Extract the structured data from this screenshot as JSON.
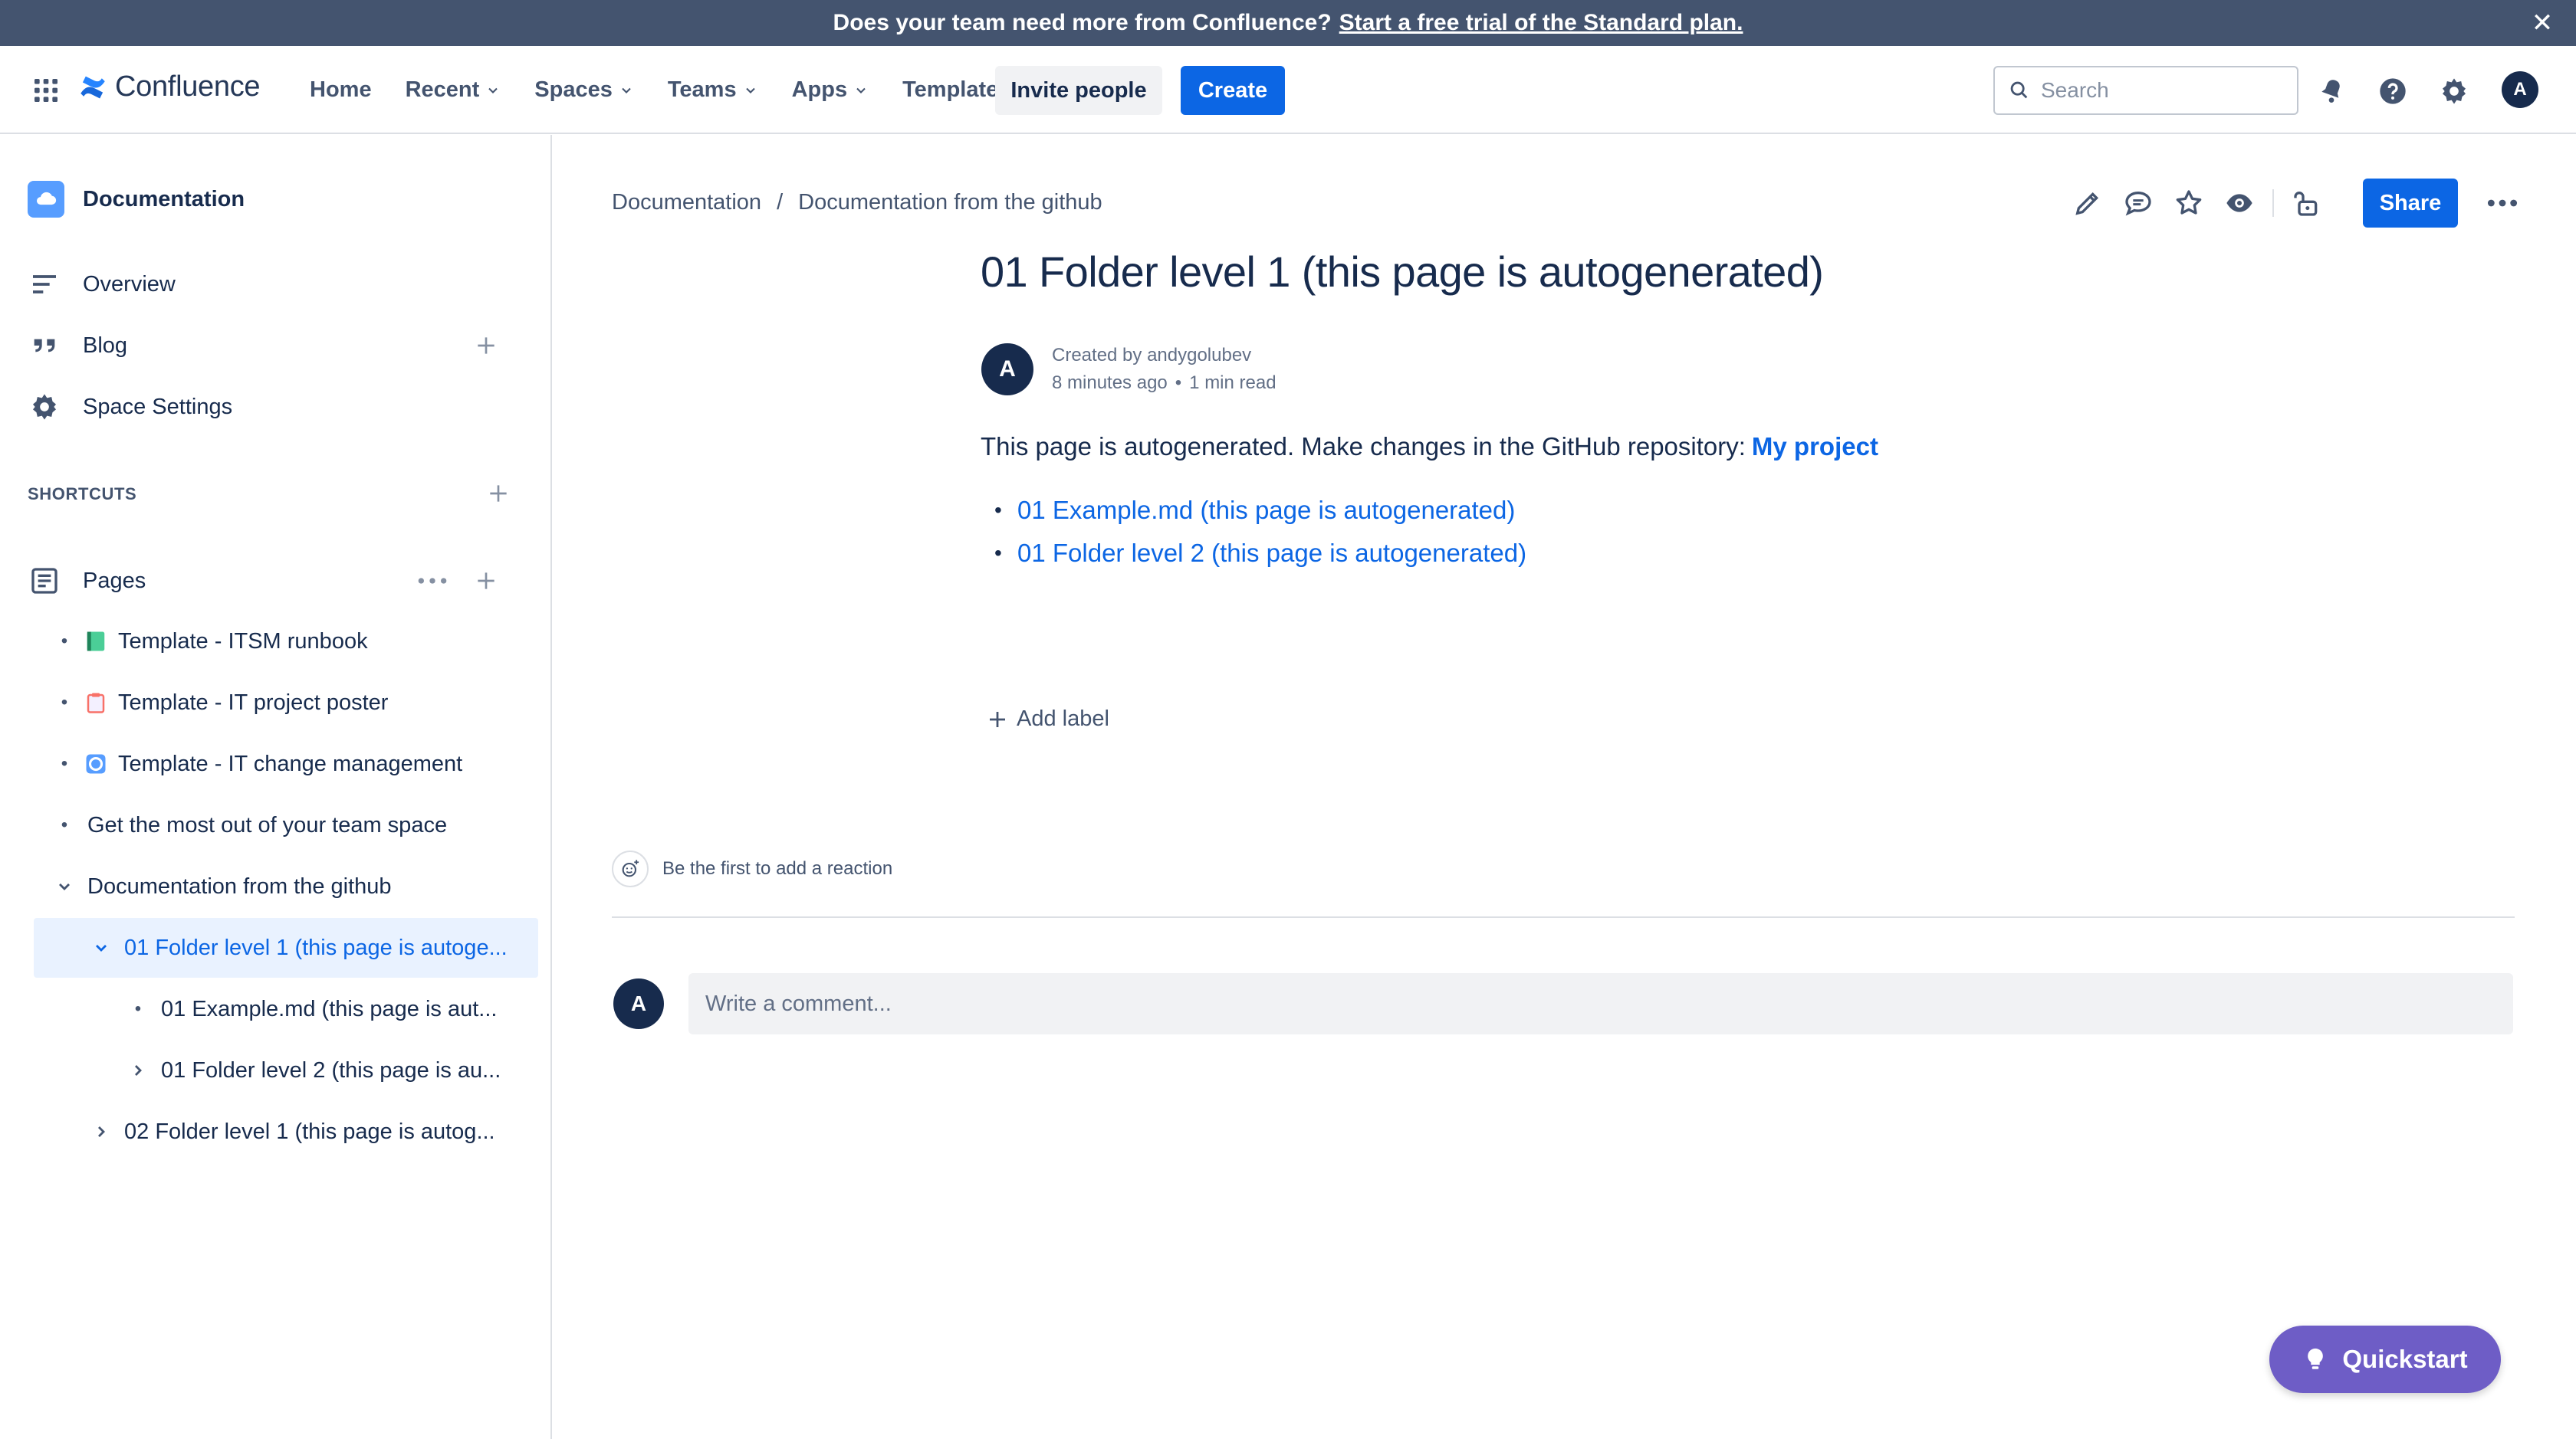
{
  "banner": {
    "text": "Does your team need more from Confluence?",
    "link": "Start a free trial of the Standard plan.",
    "close": "✕"
  },
  "topnav": {
    "brand": "Confluence",
    "items": [
      {
        "label": "Home",
        "dropdown": false
      },
      {
        "label": "Recent",
        "dropdown": true
      },
      {
        "label": "Spaces",
        "dropdown": true
      },
      {
        "label": "Teams",
        "dropdown": true
      },
      {
        "label": "Apps",
        "dropdown": true
      },
      {
        "label": "Templates",
        "dropdown": false
      }
    ],
    "invite_label": "Invite people",
    "create_label": "Create",
    "search_placeholder": "Search",
    "avatar_initial": "A"
  },
  "sidebar": {
    "space_name": "Documentation",
    "overview": "Overview",
    "blog": "Blog",
    "space_settings": "Space Settings",
    "shortcuts": "SHORTCUTS",
    "pages": "Pages",
    "tree": [
      {
        "label": "Template - ITSM runbook",
        "icon": "green-book",
        "color": "#4BCE97"
      },
      {
        "label": "Template - IT project poster",
        "icon": "clipboard",
        "color": "#F87168"
      },
      {
        "label": "Template - IT change management",
        "icon": "cycle",
        "color": "#579DFF"
      },
      {
        "label": "Get the most out of your team space"
      },
      {
        "label": "Documentation from the github"
      },
      {
        "label": "01 Folder level 1 (this page is autoge..."
      },
      {
        "label": "01 Example.md (this page is aut..."
      },
      {
        "label": "01 Folder level 2 (this page is au..."
      },
      {
        "label": "02 Folder level 1 (this page is autog..."
      }
    ]
  },
  "breadcrumb": {
    "items": [
      "Documentation",
      "Documentation from the github"
    ],
    "separator": "/"
  },
  "page_actions": {
    "share_label": "Share"
  },
  "page": {
    "title": "01 Folder level 1 (this page is autogenerated)",
    "author_initial": "A",
    "created_by": "Created by andygolubev",
    "time_ago": "8 minutes ago",
    "bullet": "•",
    "read_time": "1 min read",
    "body_text": "This page is autogenerated. Make changes in the GitHub repository:",
    "body_link": "My project",
    "children": [
      "01 Example.md (this page is autogenerated)",
      "01 Folder level 2 (this page is autogenerated)"
    ],
    "add_label": "Add label",
    "reaction_text": "Be the first to add a reaction",
    "comment_initial": "A",
    "comment_placeholder": "Write a comment..."
  },
  "quickstart": {
    "label": "Quickstart"
  },
  "colors": {
    "banner_bg": "#44546F",
    "primary": "#0C66E4",
    "quickstart": "#6E5DC6",
    "selected_bg": "#E9F2FF",
    "text": "#172B4D"
  }
}
